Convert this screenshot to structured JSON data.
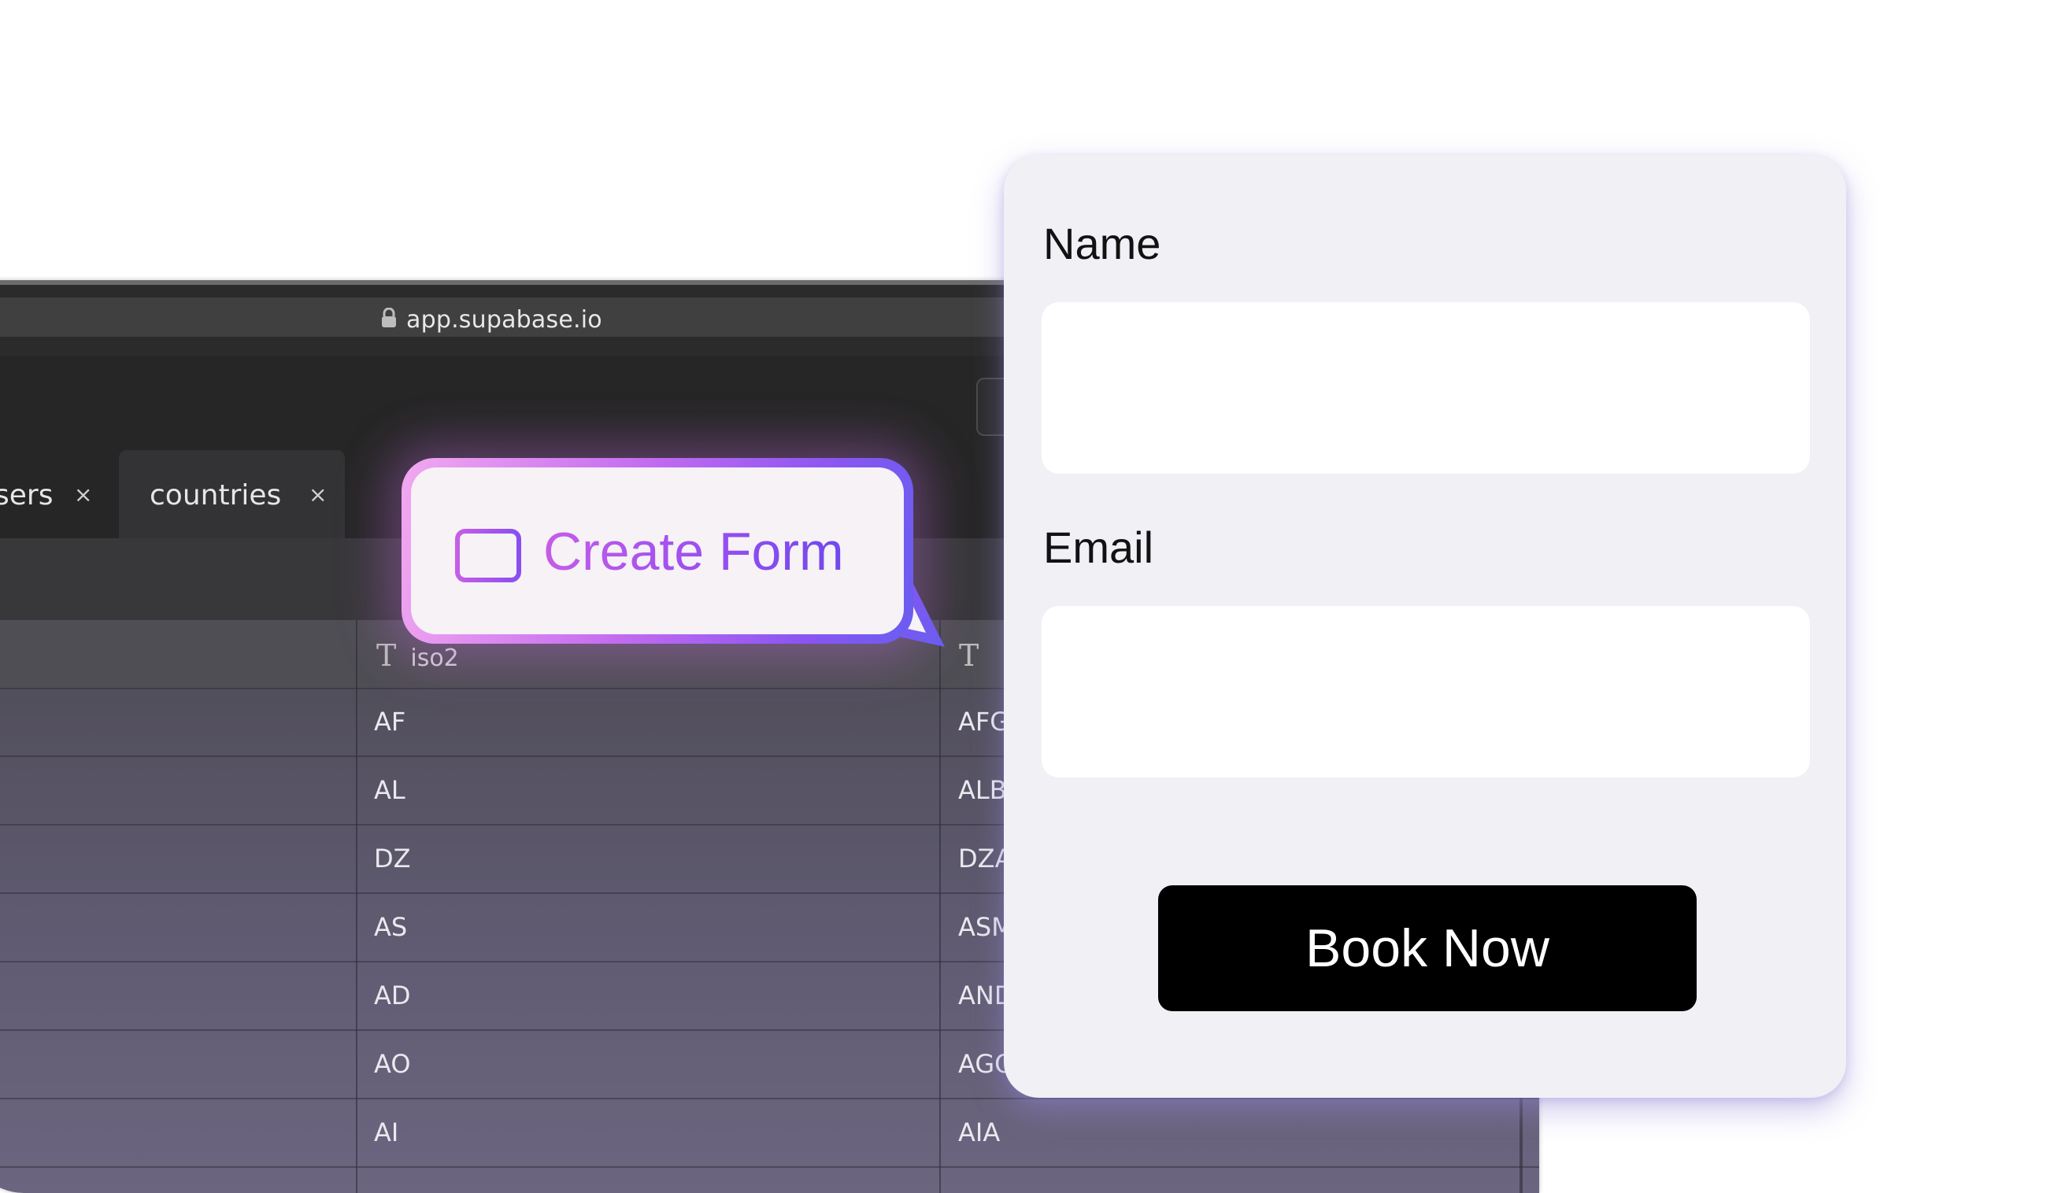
{
  "browser": {
    "url": "app.supabase.io",
    "tabs": [
      {
        "label": "sers",
        "close": "×"
      },
      {
        "label": "countries",
        "close": "×"
      }
    ],
    "table": {
      "columns": [
        {
          "type_icon": "T",
          "name": "iso2"
        },
        {
          "type_icon": "T",
          "name": ""
        }
      ],
      "rows": [
        {
          "iso2": "AF",
          "iso3": "AFG"
        },
        {
          "iso2": "AL",
          "iso3": "ALB"
        },
        {
          "iso2": "DZ",
          "iso3": "DZA"
        },
        {
          "iso2": "AS",
          "iso3": "ASM"
        },
        {
          "iso2": "AD",
          "iso3": "AND"
        },
        {
          "iso2": "AO",
          "iso3": "AGO"
        },
        {
          "iso2": "AI",
          "iso3": "AIA"
        }
      ]
    }
  },
  "callout": {
    "label": "Create Form",
    "icon": "table-icon",
    "gradient_colors": [
      "#f2a8f0",
      "#c46cf0",
      "#8a55f2",
      "#6a5df0"
    ]
  },
  "form": {
    "fields": [
      {
        "label": "Name",
        "value": ""
      },
      {
        "label": "Email",
        "value": ""
      }
    ],
    "submit_label": "Book Now"
  }
}
